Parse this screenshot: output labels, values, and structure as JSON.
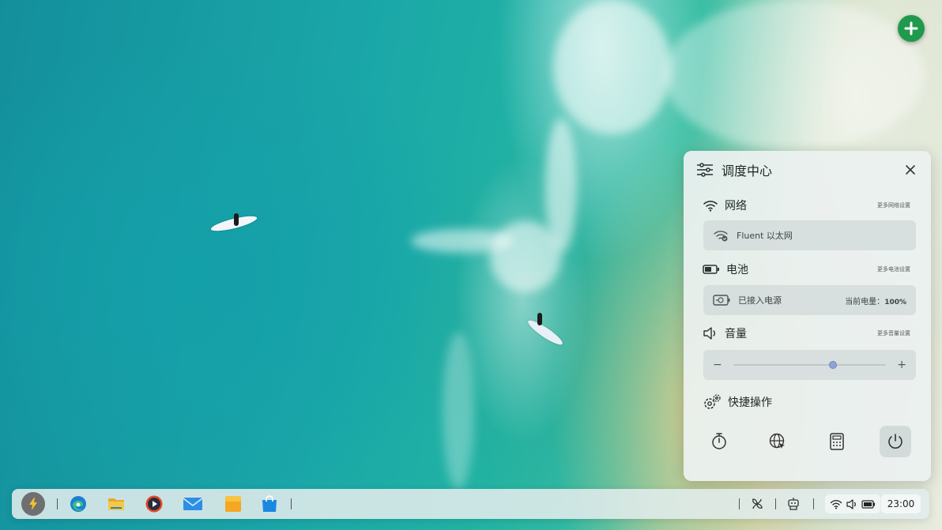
{
  "desktop": {
    "wallpaper": "aerial-surf-beach"
  },
  "add_button": {
    "icon": "plus-icon",
    "color": "#1f9a4c"
  },
  "control_center": {
    "title": "调度中心",
    "network": {
      "label": "网络",
      "more_link": "更多网络设置",
      "connection": "Fluent 以太网"
    },
    "battery": {
      "label": "电池",
      "more_link": "更多电池设置",
      "status": "已接入电源",
      "level_label": "当前电量：",
      "level_value": "100%"
    },
    "volume": {
      "label": "音量",
      "more_link": "更多音量设置",
      "minus": "−",
      "plus": "+",
      "level": 0.65
    },
    "quick_actions": {
      "label": "快捷操作",
      "items": [
        "timer-icon",
        "globe-cursor-icon",
        "calculator-icon",
        "power-icon"
      ]
    }
  },
  "taskbar": {
    "apps": [
      "start-icon",
      "edge-icon",
      "file-explorer-icon",
      "media-player-icon",
      "mail-icon",
      "notes-icon",
      "store-icon"
    ],
    "tray": [
      "fan-icon",
      "robot-icon",
      "wifi-icon",
      "speaker-icon",
      "battery-icon"
    ],
    "clock": "23:00"
  }
}
